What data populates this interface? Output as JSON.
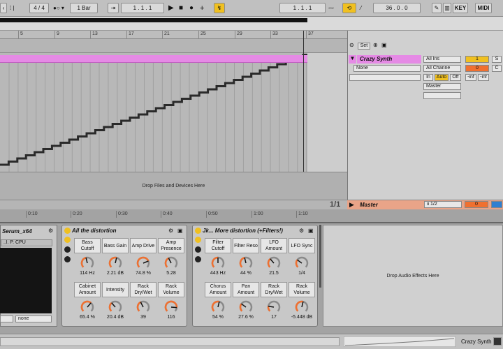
{
  "transport": {
    "sig": "4 / 4",
    "quant": "1 Bar",
    "pos1": "1 .   1 .   1",
    "pos2": "1 .   1 .   1",
    "tempo": "36 .   0 .   0",
    "key": "KEY",
    "midi": "MIDI"
  },
  "ruler": {
    "marks": [
      "5",
      "9",
      "13",
      "17",
      "21",
      "25",
      "29",
      "33",
      "37"
    ]
  },
  "arrangement": {
    "drop_text": "Drop Files and Devices Here",
    "page": "1/1"
  },
  "timeline": {
    "marks": [
      "0:10",
      "0:20",
      "0:30",
      "0:40",
      "0:50",
      "1:00",
      "1:10"
    ]
  },
  "mixer": {
    "set_label": "Set",
    "track_name": "Crazy Synth",
    "input_none": "None",
    "all_ins": "All Ins",
    "all_channels": "All Channe",
    "mon_in": "In",
    "mon_auto": "Auto",
    "mon_off": "Off",
    "output": "Master",
    "track_num": "1",
    "solo": "S",
    "vol": "0",
    "inf1": "-inf",
    "inf2": "-inf",
    "master_name": "Master",
    "master_out": "ii 1/2",
    "master_vol": "0"
  },
  "serum": {
    "title": "Serum_x64",
    "cpu": "..l. P. CPU",
    "sel1": "",
    "sel2": "none"
  },
  "devices": [
    {
      "title": "All the distortion",
      "knobs": [
        {
          "label": "Bass Cutoff",
          "value": "114 Hz",
          "amount": 0.45
        },
        {
          "label": "Bass Gain",
          "value": "2.21 dB",
          "amount": 0.55
        },
        {
          "label": "Amp Drive",
          "value": "74.8 %",
          "amount": 0.75
        },
        {
          "label": "Amp Presence",
          "value": "5.28",
          "amount": 0.4
        },
        {
          "label": "Cabinet Amount",
          "value": "65.4 %",
          "amount": 0.65
        },
        {
          "label": "Intensity",
          "value": "20.4 dB",
          "amount": 0.35
        },
        {
          "label": "Rack Dry/Wet",
          "value": "39",
          "amount": 0.4
        },
        {
          "label": "Rack Volume",
          "value": "116",
          "amount": 0.85
        }
      ]
    },
    {
      "title": "Jk... More distortion (+Filters!)",
      "knobs": [
        {
          "label": "Filter Cutoff",
          "value": "443 Hz",
          "amount": 0.5
        },
        {
          "label": "Filter Reso",
          "value": "44 %",
          "amount": 0.45
        },
        {
          "label": "LFO Amount",
          "value": "21.5",
          "amount": 0.35
        },
        {
          "label": "LFO Sync",
          "value": "1/4",
          "amount": 0.3
        },
        {
          "label": "Chorus Amount",
          "value": "54 %",
          "amount": 0.55
        },
        {
          "label": "Pan Amount",
          "value": "27.6 %",
          "amount": 0.3
        },
        {
          "label": "Rack Dry/Wet",
          "value": "17",
          "amount": 0.2
        },
        {
          "label": "Rack Volume",
          "value": "-5.448 dB",
          "amount": 0.55
        }
      ]
    }
  ],
  "drop_fx": "Drop Audio Effects Here",
  "status": {
    "track": "Crazy Synth"
  },
  "colors": {
    "accent": "#f07030",
    "clip": "#e58ae5",
    "highlight": "#f0c020"
  }
}
